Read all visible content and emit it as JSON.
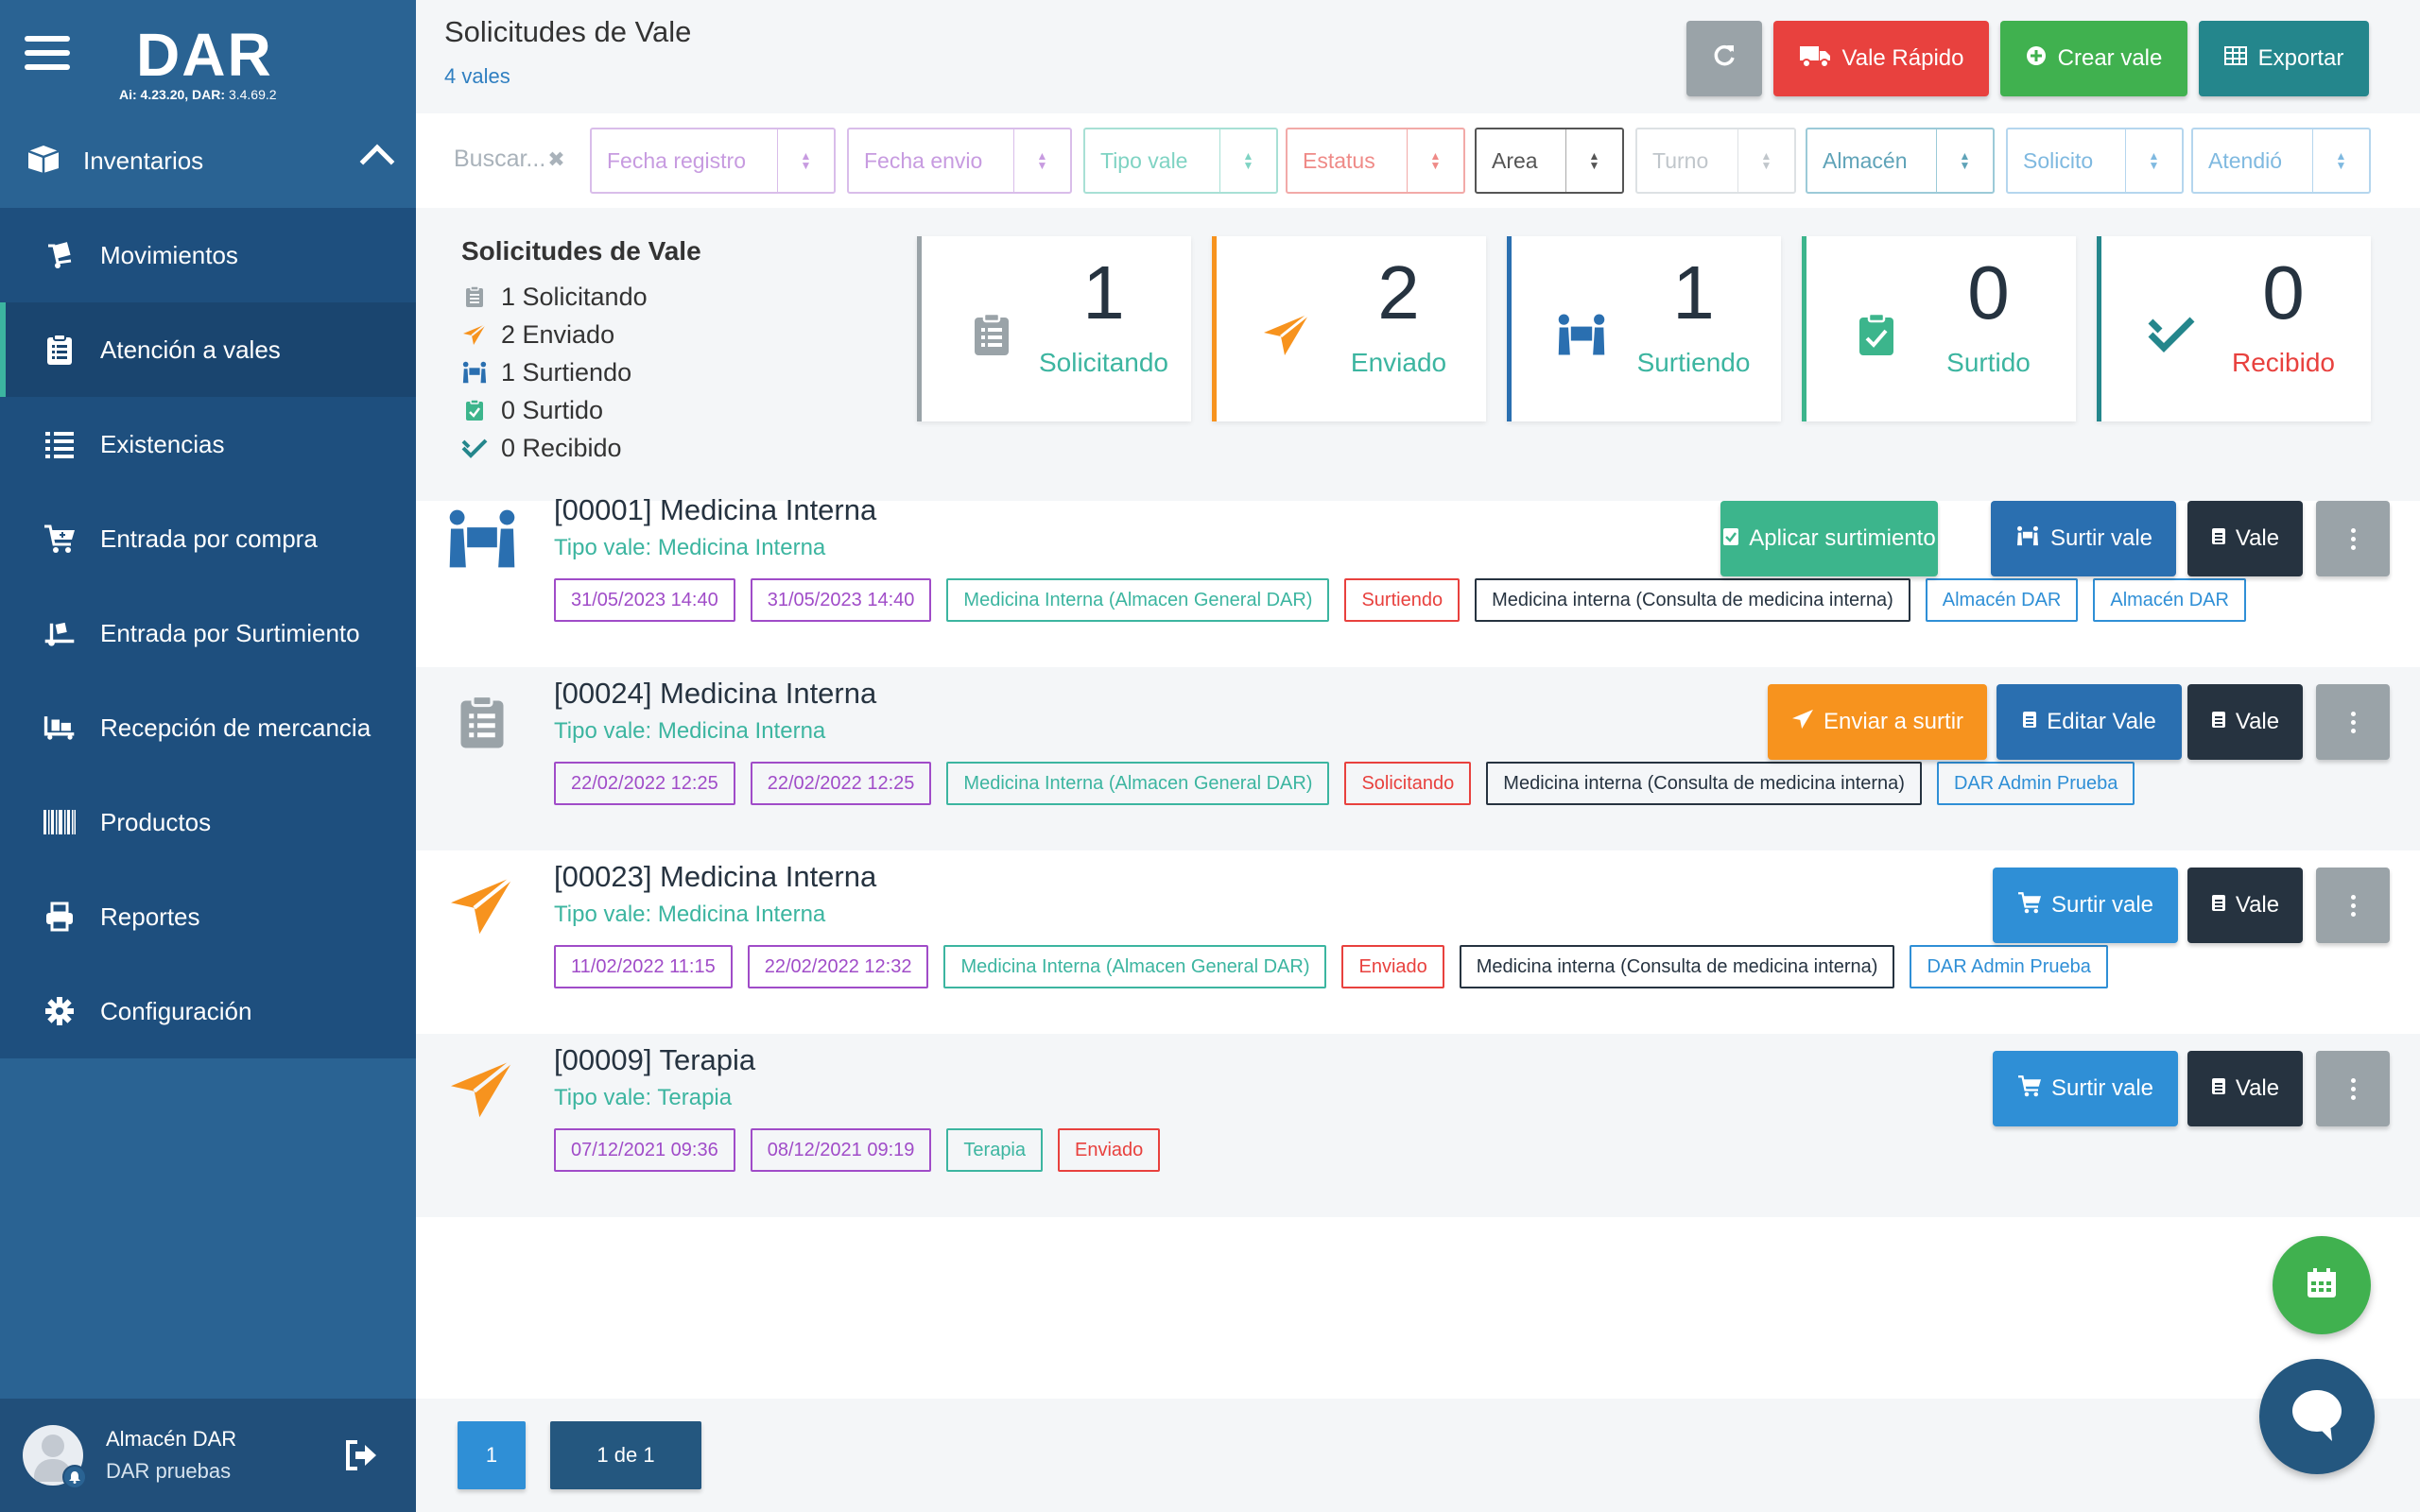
{
  "app": {
    "logo": "DAR",
    "version_prefix": "Ai: 4.23.20,",
    "version_dar_label": "DAR:",
    "version_dar": "3.4.69.2"
  },
  "sidebar": {
    "group_label": "Inventarios",
    "items": [
      {
        "label": "Movimientos",
        "icon": "dolly-icon"
      },
      {
        "label": "Atención a vales",
        "icon": "clipboard-list-icon",
        "active": true
      },
      {
        "label": "Existencias",
        "icon": "list-icon"
      },
      {
        "label": "Entrada por compra",
        "icon": "cart-plus-icon"
      },
      {
        "label": "Entrada por Surtimiento",
        "icon": "truck-loading-icon"
      },
      {
        "label": "Recepción de mercancia",
        "icon": "pallet-icon"
      },
      {
        "label": "Productos",
        "icon": "barcode-icon"
      },
      {
        "label": "Reportes",
        "icon": "print-icon"
      },
      {
        "label": "Configuración",
        "icon": "gear-icon"
      }
    ],
    "user": {
      "name": "Almacén DAR",
      "subtitle": "DAR pruebas"
    }
  },
  "header": {
    "title": "Solicitudes de Vale",
    "count": "4 vales",
    "buttons": {
      "rapido": "Vale Rápido",
      "crear": "Crear vale",
      "exportar": "Exportar"
    }
  },
  "filters": {
    "search_placeholder": "Buscar...",
    "fields": [
      {
        "label": "Fecha registro",
        "color": "#c79be0"
      },
      {
        "label": "Fecha envio",
        "color": "#c79be0"
      },
      {
        "label": "Tipo vale",
        "color": "#7fd3c3"
      },
      {
        "label": "Estatus",
        "color": "#ef8a87"
      },
      {
        "label": "Area",
        "color": "#555555"
      },
      {
        "label": "Turno",
        "color": "#c0c6cb"
      },
      {
        "label": "Almacén",
        "color": "#5fa3b8"
      },
      {
        "label": "Solicito",
        "color": "#7fb9e0"
      },
      {
        "label": "Atendió",
        "color": "#7fb9e0"
      }
    ]
  },
  "summary": {
    "title": "Solicitudes de Vale",
    "rows": [
      {
        "text": "1 Solicitando"
      },
      {
        "text": "2 Enviado"
      },
      {
        "text": "1 Surtiendo"
      },
      {
        "text": "0 Surtido"
      },
      {
        "text": "0 Recibido"
      }
    ],
    "cards": [
      {
        "value": "1",
        "label": "Solicitando",
        "color": "#9aa3a8",
        "label_color": "#3cb5a0"
      },
      {
        "value": "2",
        "label": "Enviado",
        "color": "#f7931e",
        "label_color": "#3cb5a0"
      },
      {
        "value": "1",
        "label": "Surtiendo",
        "color": "#2a6fb0",
        "label_color": "#3cb5a0"
      },
      {
        "value": "0",
        "label": "Surtido",
        "color": "#3cb58c",
        "label_color": "#3cb5a0"
      },
      {
        "value": "0",
        "label": "Recibido",
        "color": "#24868c",
        "label_color": "#e8413e"
      }
    ]
  },
  "vales": [
    {
      "title": "[00001] Medicina Interna",
      "tipo": "Tipo vale: Medicina Interna",
      "tags": [
        "31/05/2023 14:40",
        "31/05/2023 14:40",
        "Medicina Interna (Almacen General DAR)",
        "Surtiendo",
        "Medicina interna (Consulta de medicina interna)",
        "Almacén DAR",
        "Almacén DAR"
      ],
      "actions": [
        "Aplicar surtimiento",
        "Surtir vale",
        "Vale"
      ]
    },
    {
      "title": "[00024] Medicina Interna",
      "tipo": "Tipo vale: Medicina Interna",
      "tags": [
        "22/02/2022 12:25",
        "22/02/2022 12:25",
        "Medicina Interna (Almacen General DAR)",
        "Solicitando",
        "Medicina interna (Consulta de medicina interna)",
        "DAR Admin Prueba"
      ],
      "actions": [
        "Enviar a surtir",
        "Editar Vale",
        "Vale"
      ]
    },
    {
      "title": "[00023] Medicina Interna",
      "tipo": "Tipo vale: Medicina Interna",
      "tags": [
        "11/02/2022 11:15",
        "22/02/2022 12:32",
        "Medicina Interna (Almacen General DAR)",
        "Enviado",
        "Medicina interna (Consulta de medicina interna)",
        "DAR Admin Prueba"
      ],
      "actions": [
        "Surtir vale",
        "Vale"
      ]
    },
    {
      "title": "[00009] Terapia",
      "tipo": "Tipo vale: Terapia",
      "tags": [
        "07/12/2021 09:36",
        "08/12/2021 09:19",
        "Terapia",
        "Enviado"
      ],
      "actions": [
        "Surtir vale",
        "Vale"
      ]
    }
  ],
  "pagination": {
    "current": "1",
    "of": "1 de 1"
  }
}
